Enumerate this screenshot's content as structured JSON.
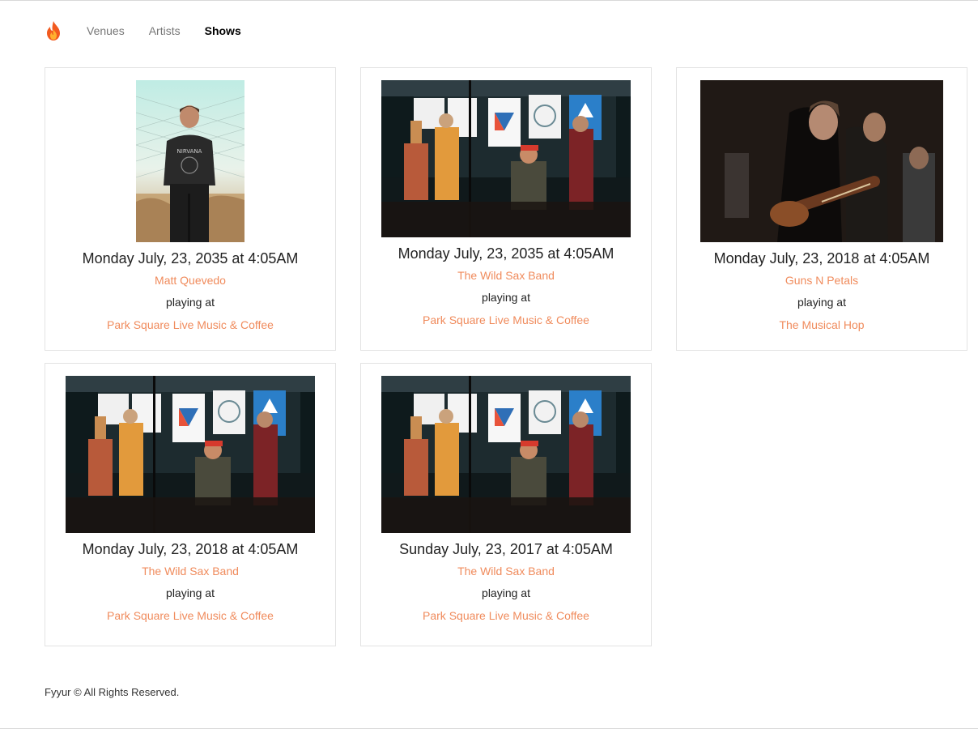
{
  "nav": {
    "logo_icon": "fire-icon",
    "links": [
      "Venues",
      "Artists",
      "Shows"
    ],
    "active": "Shows"
  },
  "shows": [
    {
      "image": "portrait-photo",
      "date": "Monday July, 23, 2035 at 4:05AM",
      "artist": "Matt Quevedo",
      "playing_text": "playing at",
      "venue": "Park Square Live Music & Coffee"
    },
    {
      "image": "band-stage-photo",
      "date": "Monday July, 23, 2035 at 4:05AM",
      "artist": "The Wild Sax Band",
      "playing_text": "playing at",
      "venue": "Park Square Live Music & Coffee"
    },
    {
      "image": "guitarist-concert-photo",
      "date": "Monday July, 23, 2018 at 4:05AM",
      "artist": "Guns N Petals",
      "playing_text": "playing at",
      "venue": "The Musical Hop"
    },
    {
      "image": "band-stage-photo",
      "date": "Monday July, 23, 2018 at 4:05AM",
      "artist": "The Wild Sax Band",
      "playing_text": "playing at",
      "venue": "Park Square Live Music & Coffee"
    },
    {
      "image": "band-stage-photo",
      "date": "Sunday July, 23, 2017 at 4:05AM",
      "artist": "The Wild Sax Band",
      "playing_text": "playing at",
      "venue": "Park Square Live Music & Coffee"
    }
  ],
  "footer": {
    "text": "Fyyur © All Rights Reserved."
  },
  "colors": {
    "link_accent": "#f08b5c",
    "nav_inactive": "#777777",
    "card_border": "#e3e3e3"
  }
}
